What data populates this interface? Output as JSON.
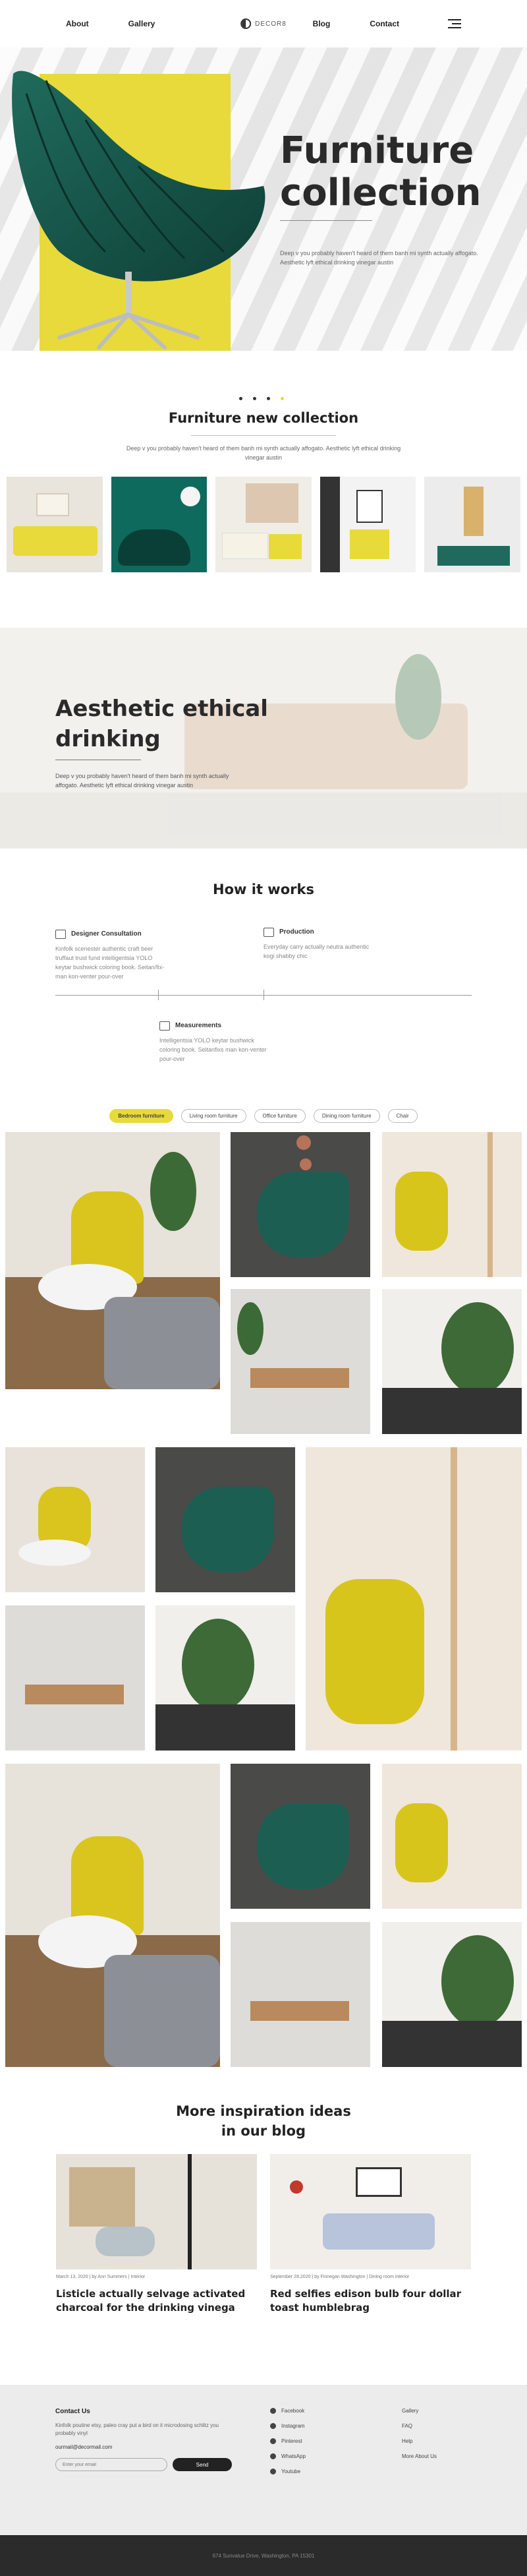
{
  "header": {
    "nav_left": [
      "About",
      "Gallery"
    ],
    "logo_text": "DECOR8",
    "nav_right": [
      "Blog",
      "Contact"
    ]
  },
  "hero": {
    "title_line1": "Furniture",
    "title_line2": "collection",
    "text": "Deep v you probably haven't heard of them banh mi synth actually affogato. Aesthetic lyft ethical drinking vinegar austin",
    "accent_color": "#e8da3a"
  },
  "new_collection": {
    "title": "Furniture new collection",
    "text": "Deep v you probably haven't heard of them banh mi synth actually affogato. Aesthetic lyft ethical drinking vinegar austin"
  },
  "aesthetic": {
    "title_line1": "Aesthetic ethical",
    "title_line2": "drinking",
    "text": "Deep v you probably haven't heard of them banh mi synth actually affogato. Aesthetic lyft ethical drinking vinegar austin"
  },
  "how": {
    "title": "How it works",
    "steps": [
      {
        "title": "Designer Consultation",
        "text": "Kinfolk scenester authentic craft beer truffaut trust fund intelligentsia YOLO keytar bushwick coloring book. Seitan/fix-man kon-venter pour-over"
      },
      {
        "title": "Production",
        "text": "Everyday carry actually neutra authentic kogi shabby chic"
      },
      {
        "title": "Measurements",
        "text": "Intelligentsia YOLO keytar bushwick coloring book. Seitanfixs man kon-venter pour-over"
      }
    ]
  },
  "filters": [
    "Bedroom furniture",
    "Living room furniture",
    "Office furniture",
    "Dining room furniture",
    "Chair"
  ],
  "blog": {
    "title_line1": "More inspiration ideas",
    "title_line2": "in our blog",
    "posts": [
      {
        "meta": "March 13, 2020  |  by Ann Summers  |  Interior",
        "title": "Listicle actually selvage activated charcoal for the drinking vinega"
      },
      {
        "meta": "September 28,2020  |  by Finnegan Washington  |  Dining room interior",
        "title": "Red selfies edison bulb four dollar toast humblebrag"
      }
    ]
  },
  "footer": {
    "contact_title": "Contact Us",
    "contact_text": "Kinfolk poutine etsy, paleo cray put a bird on it microdosing schlitz you probably vinyl",
    "email": "ourmail@decormail.com",
    "input_placeholder": "Enter your email",
    "send_label": "Send",
    "social": [
      "Facebook",
      "Instagram",
      "Pinterest",
      "WhatsApp",
      "Youtube"
    ],
    "links": [
      "Gallery",
      "FAQ",
      "Help",
      "More About Us"
    ],
    "address": "674 Sunvalue Drive, Washington, PA 15301"
  }
}
